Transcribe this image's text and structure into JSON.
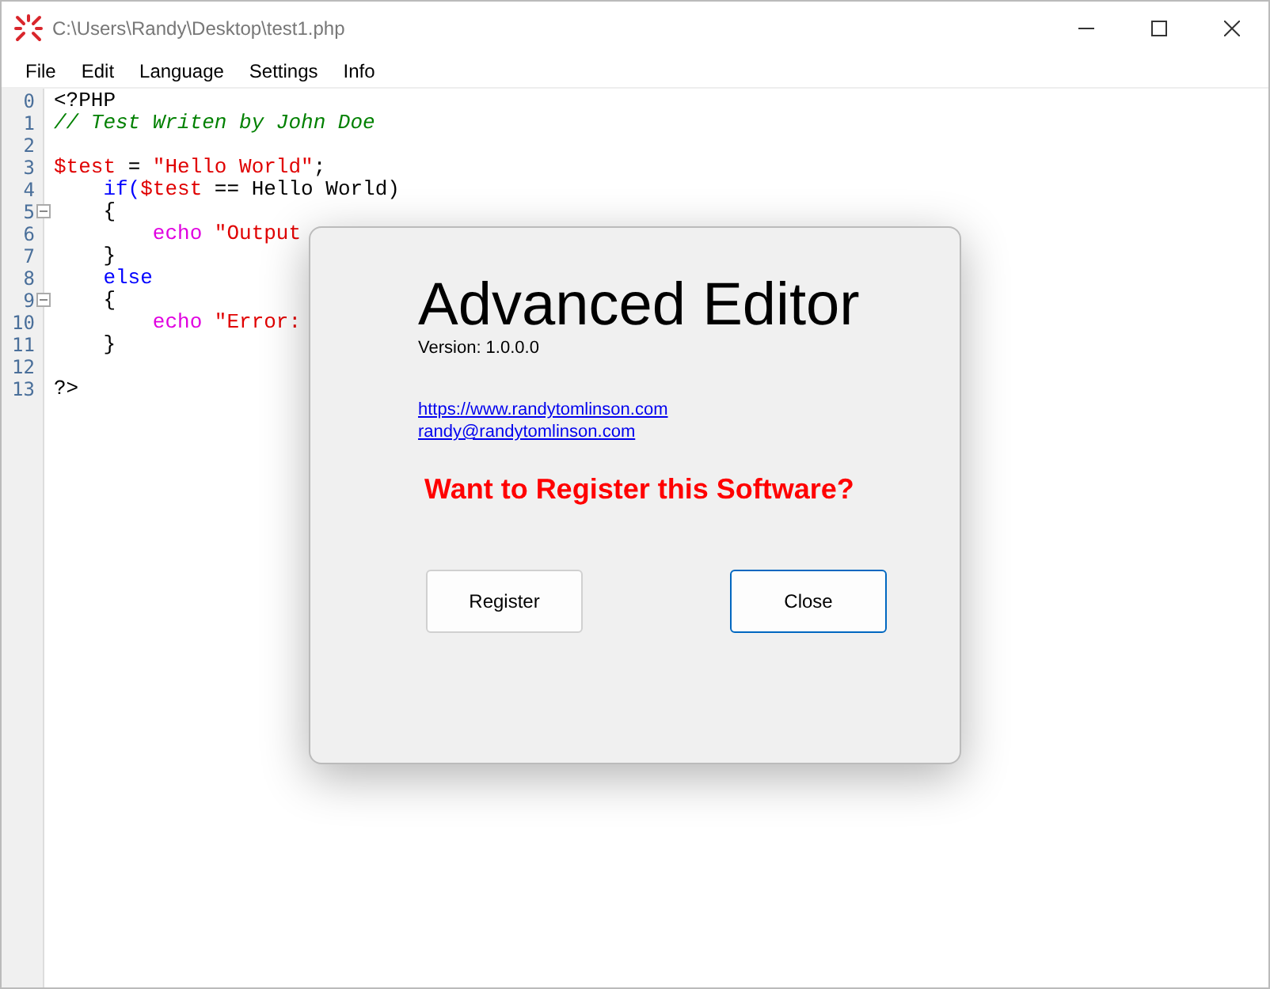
{
  "window": {
    "title": "C:\\Users\\Randy\\Desktop\\test1.php"
  },
  "menu": [
    "File",
    "Edit",
    "Language",
    "Settings",
    "Info"
  ],
  "editor": {
    "lines": [
      {
        "number": "0",
        "fold": false,
        "tokens": [
          {
            "text": "<?PHP",
            "kind": "plain"
          }
        ]
      },
      {
        "number": "1",
        "fold": false,
        "tokens": [
          {
            "text": "// Test Writen by John Doe",
            "kind": "comment"
          }
        ]
      },
      {
        "number": "2",
        "fold": false
      },
      {
        "number": "3",
        "fold": false,
        "tokens": [
          {
            "text": "$test",
            "kind": "variable"
          },
          {
            "text": " = ",
            "kind": "plain"
          },
          {
            "text": "\"Hello World\"",
            "kind": "string"
          },
          {
            "text": ";",
            "kind": "plain"
          }
        ]
      },
      {
        "number": "4",
        "fold": false,
        "tokens": [
          {
            "text": "    if(",
            "kind": "keyword"
          },
          {
            "text": "$test",
            "kind": "variable"
          },
          {
            "text": " == Hello World)",
            "kind": "plain"
          }
        ]
      },
      {
        "number": "5",
        "fold": true,
        "tokens": [
          {
            "text": "    {",
            "kind": "plain"
          }
        ]
      },
      {
        "number": "6",
        "fold": false,
        "tokens": [
          {
            "text": "        echo",
            "kind": "function"
          },
          {
            "text": " \"Output",
            "kind": "string"
          }
        ]
      },
      {
        "number": "7",
        "fold": false,
        "tokens": [
          {
            "text": "    }",
            "kind": "plain"
          }
        ]
      },
      {
        "number": "8",
        "fold": false,
        "tokens": [
          {
            "text": "    else",
            "kind": "keyword"
          }
        ]
      },
      {
        "number": "9",
        "fold": true,
        "tokens": [
          {
            "text": "    {",
            "kind": "plain"
          }
        ]
      },
      {
        "number": "10",
        "fold": false,
        "tokens": [
          {
            "text": "        echo",
            "kind": "function"
          },
          {
            "text": " \"Error:",
            "kind": "string"
          }
        ]
      },
      {
        "number": "11",
        "fold": false,
        "tokens": [
          {
            "text": "    }",
            "kind": "plain"
          }
        ]
      },
      {
        "number": "12",
        "fold": false
      },
      {
        "number": "13",
        "fold": false,
        "tokens": [
          {
            "text": "?>",
            "kind": "plain"
          }
        ]
      }
    ]
  },
  "dialog": {
    "title": "Advanced Editor",
    "version": "Version: 1.0.0.0",
    "links": [
      "https://www.randytomlinson.com",
      "randy@randytomlinson.com"
    ],
    "prompt": "Want to Register this Software?",
    "buttons": [
      {
        "label": "Register",
        "default": false
      },
      {
        "label": "Close",
        "default": true
      }
    ]
  }
}
